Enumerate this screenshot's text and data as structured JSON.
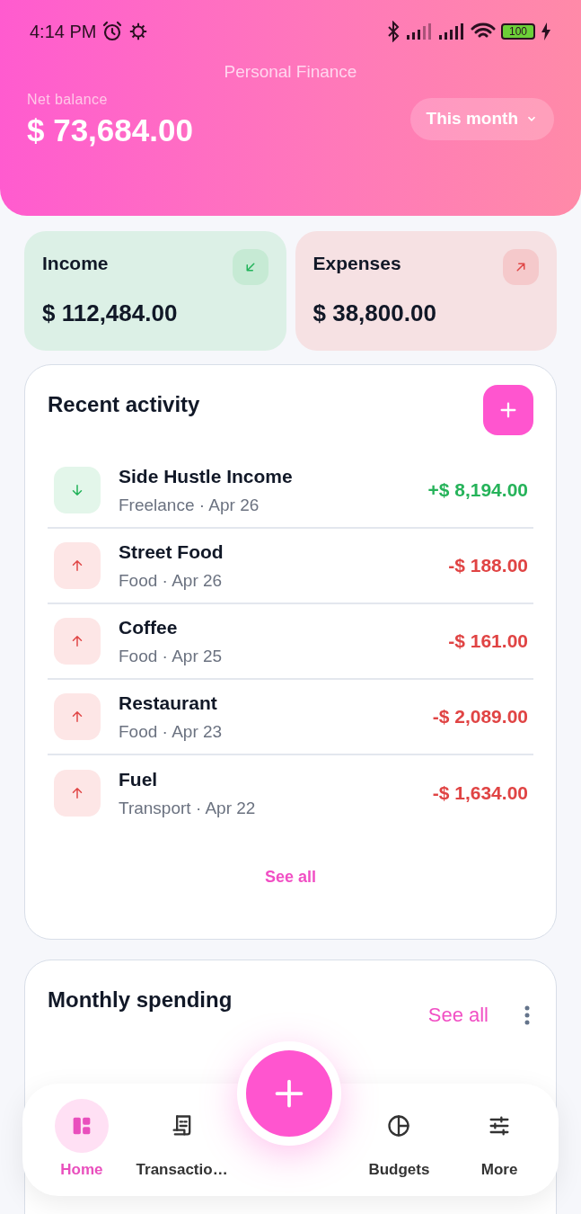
{
  "status_bar": {
    "time": "4:14 PM",
    "battery": "100"
  },
  "header": {
    "title": "Personal Finance",
    "balance_label": "Net balance",
    "balance": "$ 73,684.00",
    "period": "This month"
  },
  "summary": [
    {
      "kind": "income",
      "label": "Income",
      "amount": "$ 112,484.00"
    },
    {
      "kind": "expense",
      "label": "Expenses",
      "amount": "$ 38,800.00"
    }
  ],
  "recent": {
    "title": "Recent activity",
    "see_all": "See all",
    "items": [
      {
        "kind": "income",
        "name": "Side Hustle Income",
        "meta": "Freelance · Apr 26",
        "amount": "+$ 8,194.00"
      },
      {
        "kind": "expense",
        "name": "Street Food",
        "meta": "Food · Apr 26",
        "amount": "-$ 188.00"
      },
      {
        "kind": "expense",
        "name": "Coffee",
        "meta": "Food · Apr 25",
        "amount": "-$ 161.00"
      },
      {
        "kind": "expense",
        "name": "Restaurant",
        "meta": "Food · Apr 23",
        "amount": "-$ 2,089.00"
      },
      {
        "kind": "expense",
        "name": "Fuel",
        "meta": "Transport · Apr 22",
        "amount": "-$ 1,634.00"
      }
    ]
  },
  "monthly": {
    "title": "Monthly spending",
    "see_all": "See all"
  },
  "nav": [
    {
      "kind": "home",
      "label": "Home",
      "selected": true
    },
    {
      "kind": "transactions",
      "label": "Transactio…",
      "selected": false
    },
    {
      "kind": "budgets",
      "label": "Budgets",
      "selected": false
    },
    {
      "kind": "more",
      "label": "More",
      "selected": false
    }
  ]
}
